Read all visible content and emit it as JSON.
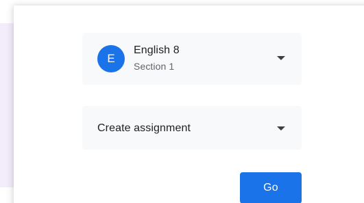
{
  "class_selector": {
    "avatar_letter": "E",
    "class_name": "English 8",
    "section": "Section 1",
    "icon": "dropdown-caret"
  },
  "action_selector": {
    "selected": "Create assignment",
    "icon": "dropdown-caret"
  },
  "go_button": {
    "label": "Go"
  },
  "colors": {
    "accent": "#1a73e8",
    "dropdown_bg": "#f8f9fa",
    "backdrop": "#f3ecfb",
    "text_primary": "#202124",
    "text_secondary": "#5f6368"
  }
}
